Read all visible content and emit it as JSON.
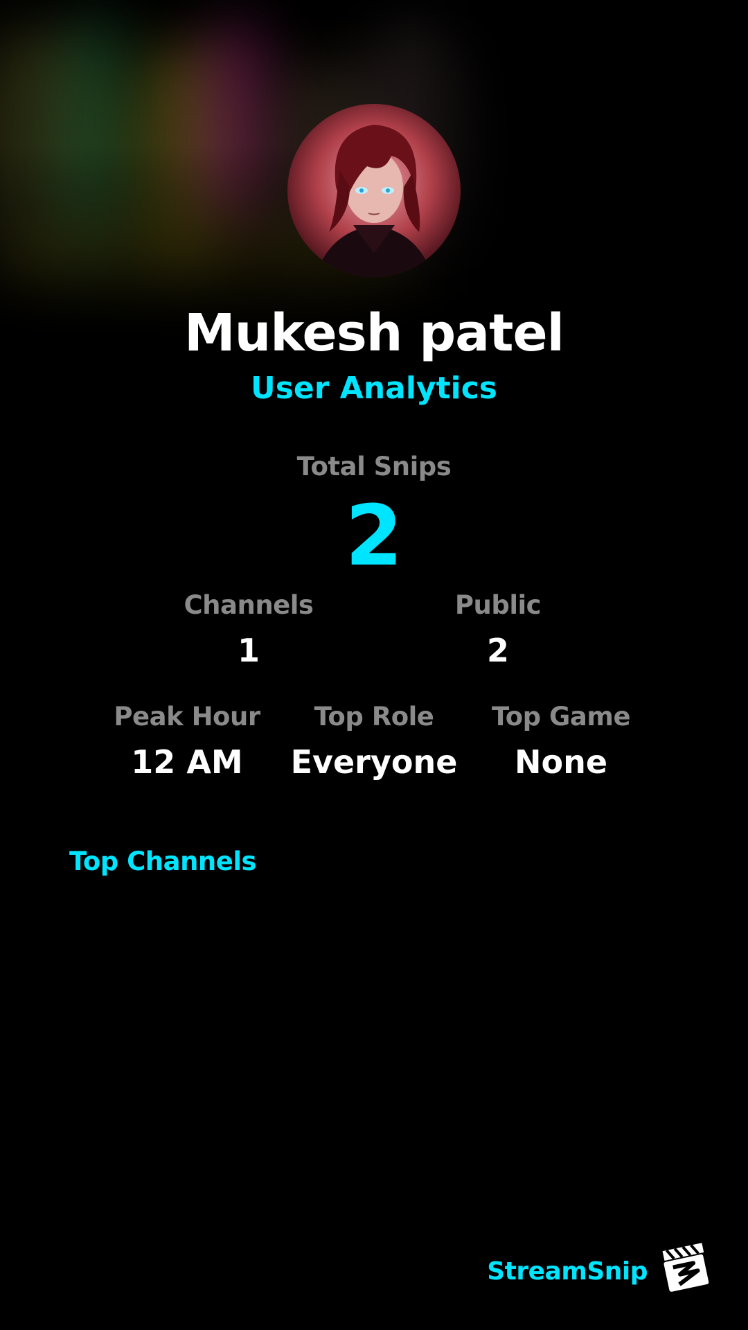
{
  "profile": {
    "name": "Mukesh patel",
    "subtitle": "User Analytics"
  },
  "stats": {
    "total_snips_label": "Total Snips",
    "total_snips_value": "2",
    "channels_label": "Channels",
    "channels_value": "1",
    "public_label": "Public",
    "public_value": "2",
    "peak_hour_label": "Peak Hour",
    "peak_hour_value": "12 AM",
    "top_role_label": "Top Role",
    "top_role_value": "Everyone",
    "top_game_label": "Top Game",
    "top_game_value": "None"
  },
  "sections": {
    "top_channels_title": "Top Channels"
  },
  "brand": {
    "name": "StreamSnip"
  },
  "colors": {
    "accent": "#00e5ff",
    "label": "#8a8a8a",
    "background": "#000000"
  }
}
